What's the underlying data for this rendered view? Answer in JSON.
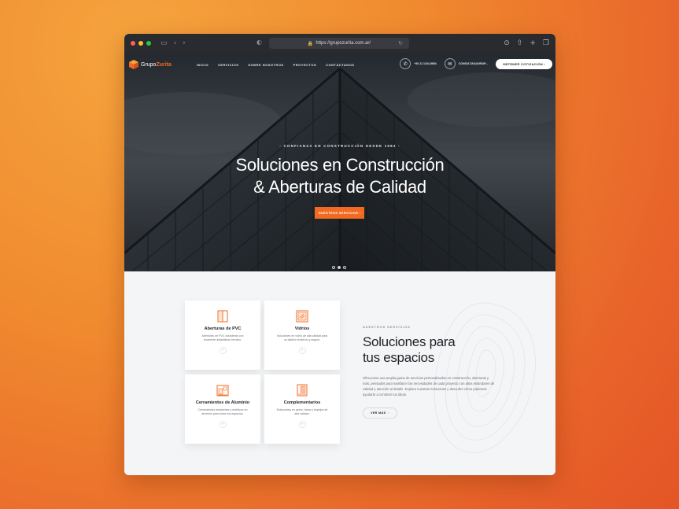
{
  "browser": {
    "url": "https://grupozurita.com.ar/"
  },
  "nav": {
    "logo_light": "Grupo",
    "logo_bold": "Zurita",
    "menu": [
      "INICIO",
      "SERVICIOS",
      "SOBRE NOSOTROS",
      "PROYECTOS",
      "CONTÁCTANOS"
    ],
    "phone": "+54 11 1234-5654",
    "email": "CONSULTAS@GRUP...",
    "cta": "OBTENER COTIZACIÓN"
  },
  "hero": {
    "kicker": "- CONFIANZA EN CONSTRUCCIÓN DESDE 1984 -",
    "title_line1": "Soluciones en Construcción",
    "title_line2": "& Aberturas de Calidad",
    "button": "NUESTROS SERVICIOS",
    "slides": 3,
    "active_slide": 2
  },
  "services": {
    "cards": [
      {
        "title": "Aberturas de PVC",
        "desc": "Aberturas de PVC duraderas con excelente aislamiento térmico.",
        "icon": "door-icon"
      },
      {
        "title": "Vidrios",
        "desc": "Soluciones en vidrio de alta calidad para un diseño moderno y seguro.",
        "icon": "glass-window-icon"
      },
      {
        "title": "Cerramientos de Aluminio",
        "desc": "Cerramientos resistentes y estéticos en aluminio para todos los espacios.",
        "icon": "aluminum-enclosure-icon"
      },
      {
        "title": "Complementarios",
        "desc": "Estructuras en acero, barra y espejos de alta calidad.",
        "icon": "complementary-icon"
      }
    ],
    "kicker": "NUESTROS SERVICIOS",
    "title_line1": "Soluciones para",
    "title_line2": "tus espacios",
    "text": "Ofrecemos una amplia gama de servicios personalizados en construcción, aberturas y más, pensados para satisfacer las necesidades de cada proyecto con altos estándares de calidad y atención al detalle. Explora nuestras soluciones y descubre cómo podemos ayudarte a construir tus ideas.",
    "button": "VER MÁS"
  },
  "colors": {
    "accent": "#f26a21",
    "dark": "#1f2125"
  }
}
